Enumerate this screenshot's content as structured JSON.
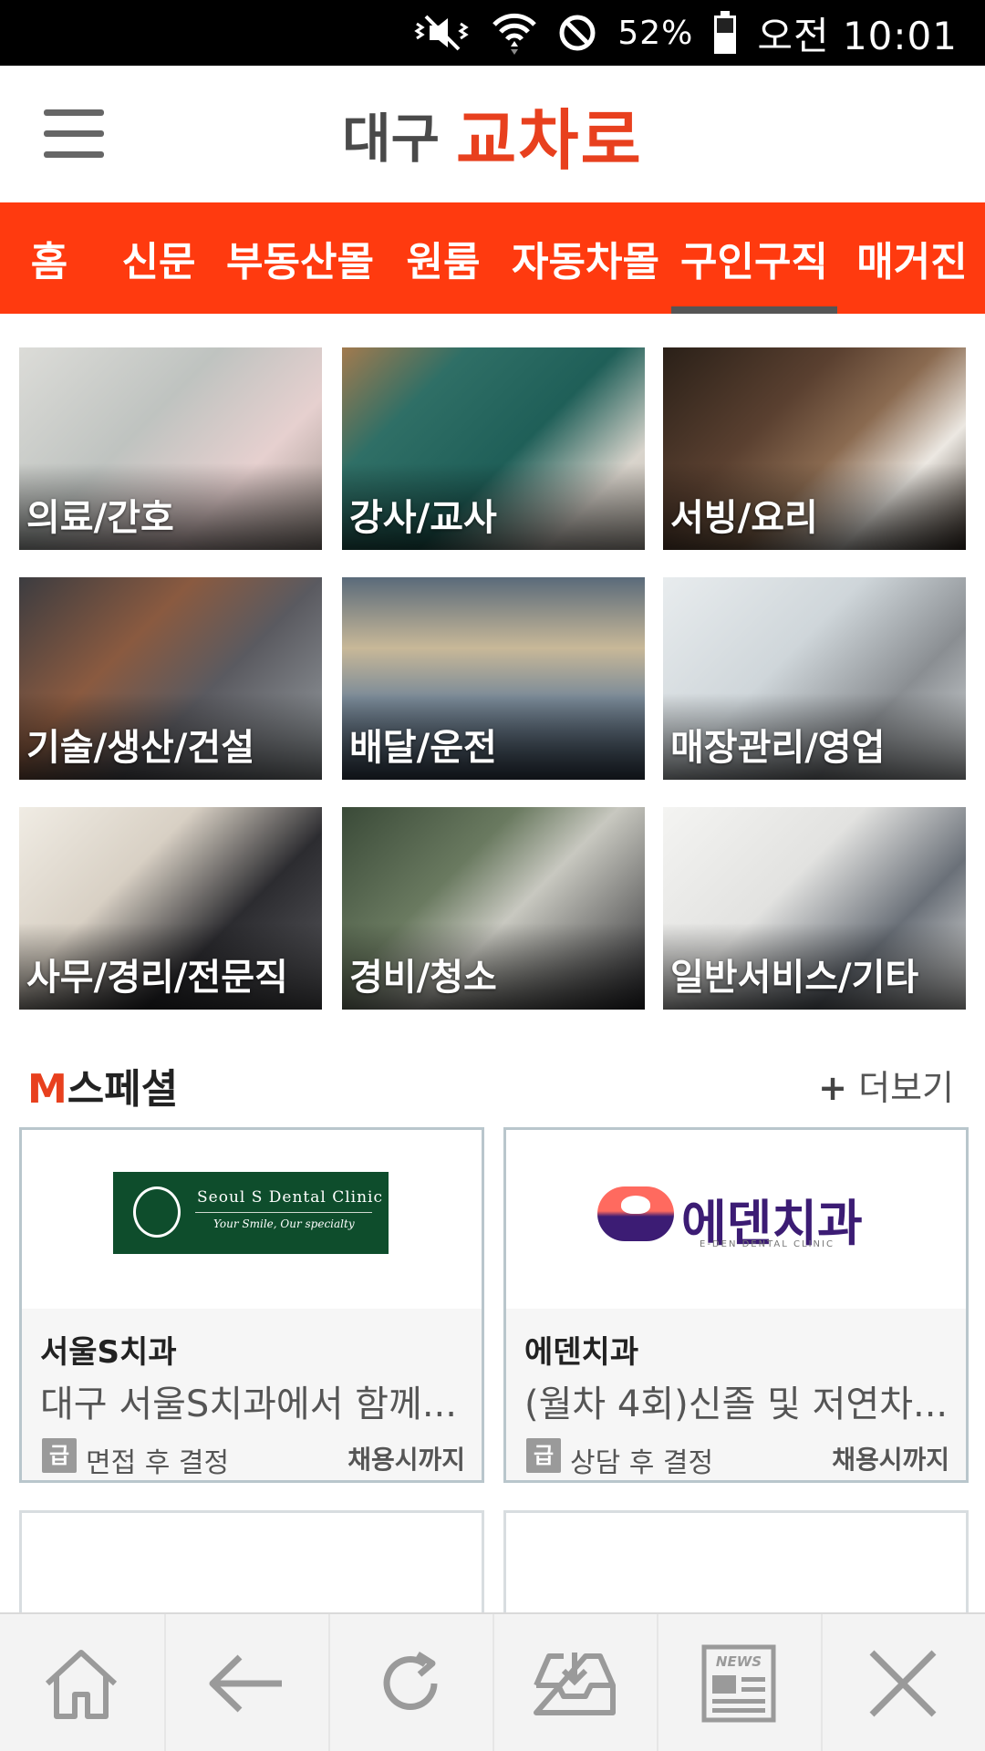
{
  "status_bar": {
    "battery_percent": "52%",
    "time": "오전 10:01",
    "icons": [
      "mute-vibrate-icon",
      "wifi-icon",
      "do-not-disturb-icon",
      "battery-icon"
    ]
  },
  "header": {
    "menu_icon": "hamburger-menu-icon",
    "logo_city": "대구",
    "logo_brand": "교차로",
    "brand_color": "#e8401e"
  },
  "tabs": [
    {
      "label": "홈",
      "active": false
    },
    {
      "label": "신문",
      "active": false
    },
    {
      "label": "부동산몰",
      "active": false
    },
    {
      "label": "원룸",
      "active": false
    },
    {
      "label": "자동차몰",
      "active": false
    },
    {
      "label": "구인구직",
      "active": true
    },
    {
      "label": "매거진",
      "active": false
    }
  ],
  "tab_bar_color": "#ff3a0f",
  "categories": [
    {
      "label": "의료/간호"
    },
    {
      "label": "강사/교사"
    },
    {
      "label": "서빙/요리"
    },
    {
      "label": "기술/생산/건설"
    },
    {
      "label": "배달/운전"
    },
    {
      "label": "매장관리/영업"
    },
    {
      "label": "사무/경리/전문직"
    },
    {
      "label": "경비/청소"
    },
    {
      "label": "일반서비스/기타"
    }
  ],
  "special": {
    "title_m": "M",
    "title_rest": "스페셜",
    "more_plus": "+",
    "more_label": "더보기",
    "cards": [
      {
        "logo_line1": "Seoul S Dental Clinic",
        "logo_line2": "Your Smile, Our specialty",
        "name": "서울S치과",
        "desc": "대구 서울S치과에서 함께...",
        "pay_icon": "급",
        "pay": "면접 후 결정",
        "until": "채용시까지"
      },
      {
        "logo_text": "에덴치과",
        "logo_sub": "E-DEN DENTAL CLINIC",
        "name": "에덴치과",
        "desc": "(월차 4회)신졸 및 저연차...",
        "pay_icon": "급",
        "pay": "상담 후 결정",
        "until": "채용시까지"
      }
    ]
  },
  "bottom_bar": {
    "buttons": [
      "home-icon",
      "back-arrow-icon",
      "refresh-icon",
      "download-icon",
      "news-icon",
      "close-icon"
    ],
    "news_label": "NEWS"
  }
}
